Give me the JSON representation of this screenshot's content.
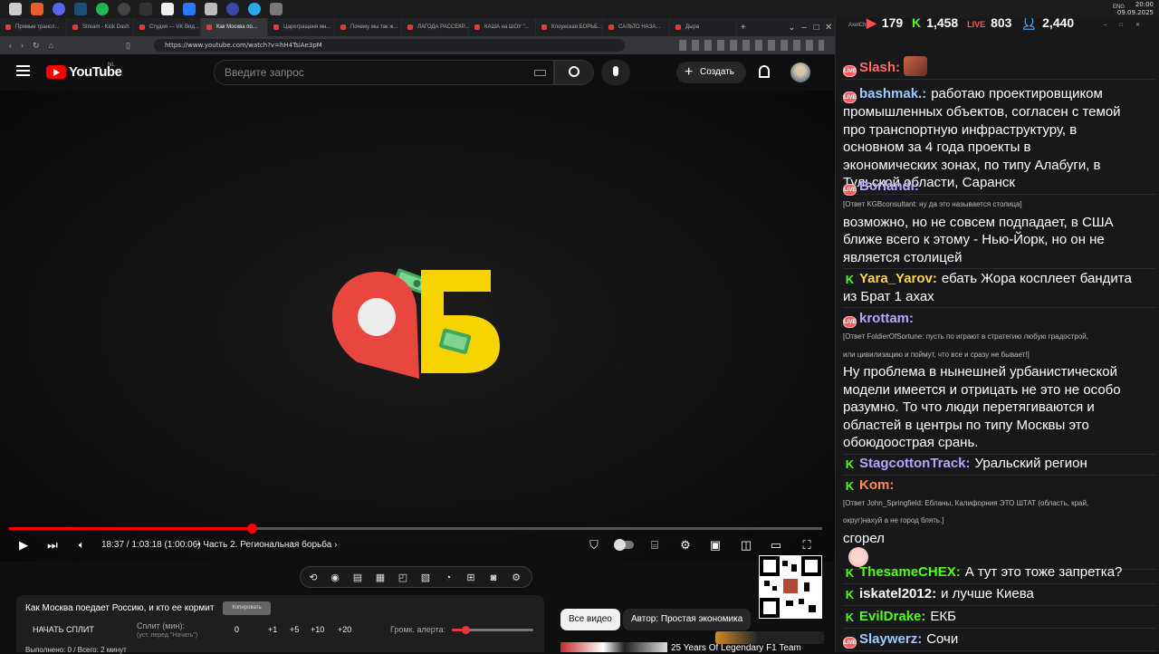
{
  "taskbar": {
    "time": "20:00",
    "date": "09.09.2025",
    "lang": "ENG"
  },
  "browser": {
    "tabs": [
      "Прямые трансл...",
      "Stream - Kick Dash",
      "Студия — VK Вид...",
      "Как Москва по...",
      "Царегращеня мн...",
      "Почему мы так ж...",
      "ЛАГОДА РАССЕКР...",
      "КАША на ШОУ \"...",
      "Клоунская БОРЬБ...",
      "САЛЬТО НАЗА...",
      "Дыра"
    ],
    "url": "https://www.youtube.com/watch?v=hH4TsiAe3pM"
  },
  "youtube": {
    "logo_text": "YouTube",
    "region": "NL",
    "search_placeholder": "Введите запрос",
    "create_label": "Создать"
  },
  "player": {
    "timecode": "18:37 / 1:03:18 (1:00:06)",
    "chapter": "• Часть 2. Региональная борьба",
    "progress_played": 0.298,
    "logo_letter": "Б"
  },
  "info": {
    "title": "Как Москва поедает Россию, и кто ее кормит",
    "copy_label": "Копировать",
    "split_button": "НАЧАТЬ СПЛИТ",
    "split_label": "Сплит (мин):",
    "split_sub": "(уст. перед \"Начать\")",
    "split_value": "0",
    "increments": [
      "+1",
      "+5",
      "+10",
      "+20"
    ],
    "alert_label": "Громк. алерта:",
    "alert_level": 0.17,
    "footer": "Выполнено: 0 / Всего: 2 минут"
  },
  "chips": {
    "all": "Все видео",
    "author": "Автор: Простая экономика",
    "next_title": "25 Years Of Legendary F1 Team"
  },
  "chat": {
    "title": "AxelChat",
    "stats": [
      "179",
      "1,458",
      "803",
      "2,440"
    ],
    "messages": [
      {
        "platform": "live",
        "user": "Slash:",
        "color": "#ff6b6b",
        "lines": []
      },
      {
        "platform": "live",
        "user": "bashmak.:",
        "color": "#9ecbff",
        "lines": [
          "работаю проектировщиком",
          "промышленных объектов, согласен с темой",
          "про транспортную инфраструктуру, в",
          "основном за 4 года проекты в",
          "экономических зонах, по типу Алабуги, в",
          "Тульской области, Саранск"
        ]
      },
      {
        "platform": "live",
        "user": "Borlandi:",
        "color": "#b8a6ff",
        "reply": "[Ответ KGBconsultant: ну да это называется столица]",
        "lines": [
          "возможно, но не совсем подпадает, в США",
          "ближе всего к этому - Нью-Йорк, но он не",
          "является столицей"
        ]
      },
      {
        "platform": "kick",
        "user": "Yara_Yarov:",
        "color": "#ffd34d",
        "lines": [
          "ебать Жора косплеет бандита",
          "из Брат 1 ахах"
        ]
      },
      {
        "platform": "live",
        "user": "krottam:",
        "color": "#b8a6ff",
        "reply": "[Ответ FoldierOfSortune: пусть по играют в стратегию любую градострой,",
        "reply2": "или цивилизацию и поймут, что все и сразу не бывает!]",
        "lines": [
          "Ну проблема в нынешней урбанистической",
          "модели имеется и отрицать не это не особо",
          "разумно. То что люди перетягиваются и",
          "областей в центры по типу Москвы это",
          "обоюдоострая срань."
        ]
      },
      {
        "platform": "kick",
        "user": "StagcottonTrack:",
        "color": "#b8a6ff",
        "lines": [
          "Уральский регион"
        ]
      },
      {
        "platform": "kick",
        "user": "Kom:",
        "color": "#ff8c5a",
        "reply": "[Ответ John_Springfield: Ебланы, Калифорния ЭТО ШТАТ (область, край,",
        "reply2": "округ)нахуй а не город блять.]",
        "lines": [
          "сгорел"
        ]
      },
      {
        "platform": "kick",
        "user": "ThesameCHEX:",
        "color": "#53fc18",
        "lines": [
          "А тут это тоже запретка?"
        ]
      },
      {
        "platform": "kick",
        "user": "iskatel2012:",
        "color": "#ffffff",
        "lines": [
          "и лучше Киева"
        ]
      },
      {
        "platform": "kick",
        "user": "EvilDrake:",
        "color": "#53fc18",
        "lines": [
          "ЕКБ"
        ]
      },
      {
        "platform": "live",
        "user": "Slaywerz:",
        "color": "#9ecbff",
        "lines": [
          "Сочи"
        ]
      }
    ]
  },
  "colors": {
    "accent": "#ff0000",
    "logo_red": "#e8473f",
    "logo_yellow": "#f5d400",
    "kick_green": "#53fc18"
  }
}
